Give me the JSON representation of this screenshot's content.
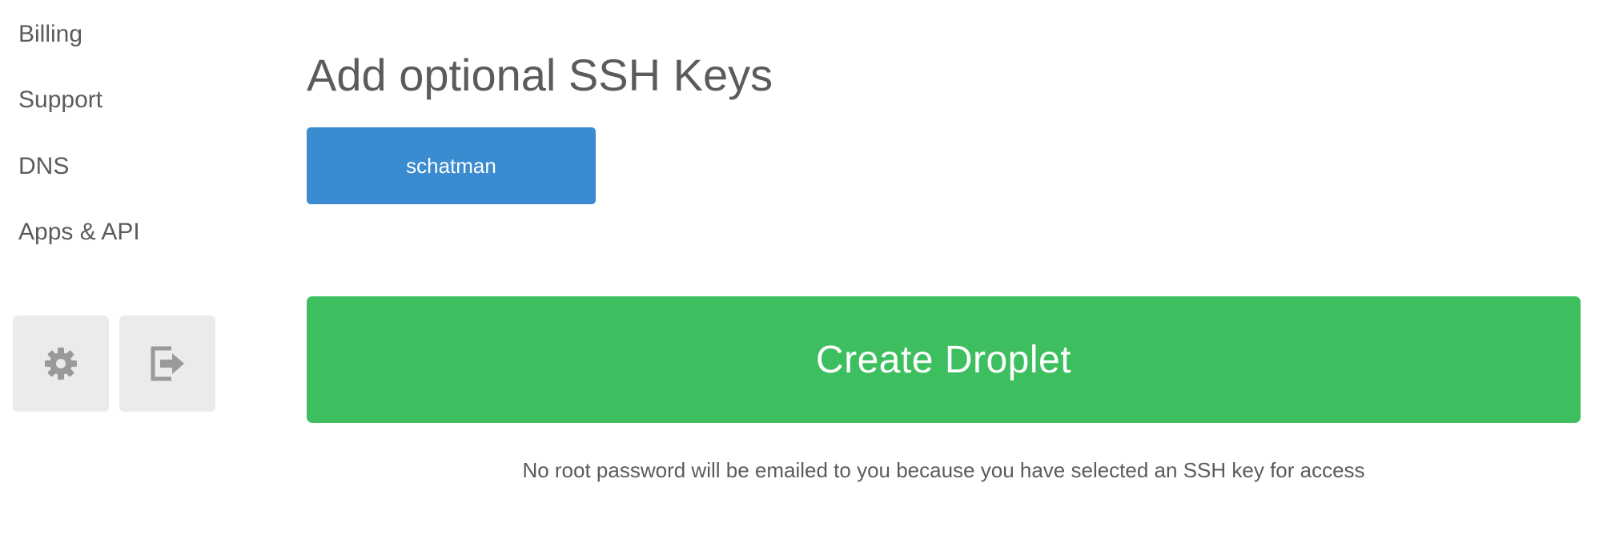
{
  "sidebar": {
    "items": [
      {
        "label": "Billing"
      },
      {
        "label": "Support"
      },
      {
        "label": "DNS"
      },
      {
        "label": "Apps & API"
      }
    ],
    "settings_icon": "gear-icon",
    "logout_icon": "logout-icon"
  },
  "main": {
    "section_title": "Add optional SSH Keys",
    "ssh_keys": [
      {
        "name": "schatman",
        "selected": true
      }
    ],
    "create_button_label": "Create Droplet",
    "note": "No root password will be emailed to you because you have selected an SSH key for access"
  },
  "colors": {
    "selected_key": "#3a8bcf",
    "create_button": "#3dbf5f",
    "icon_button_bg": "#ebebeb",
    "text": "#5b5b5b"
  }
}
